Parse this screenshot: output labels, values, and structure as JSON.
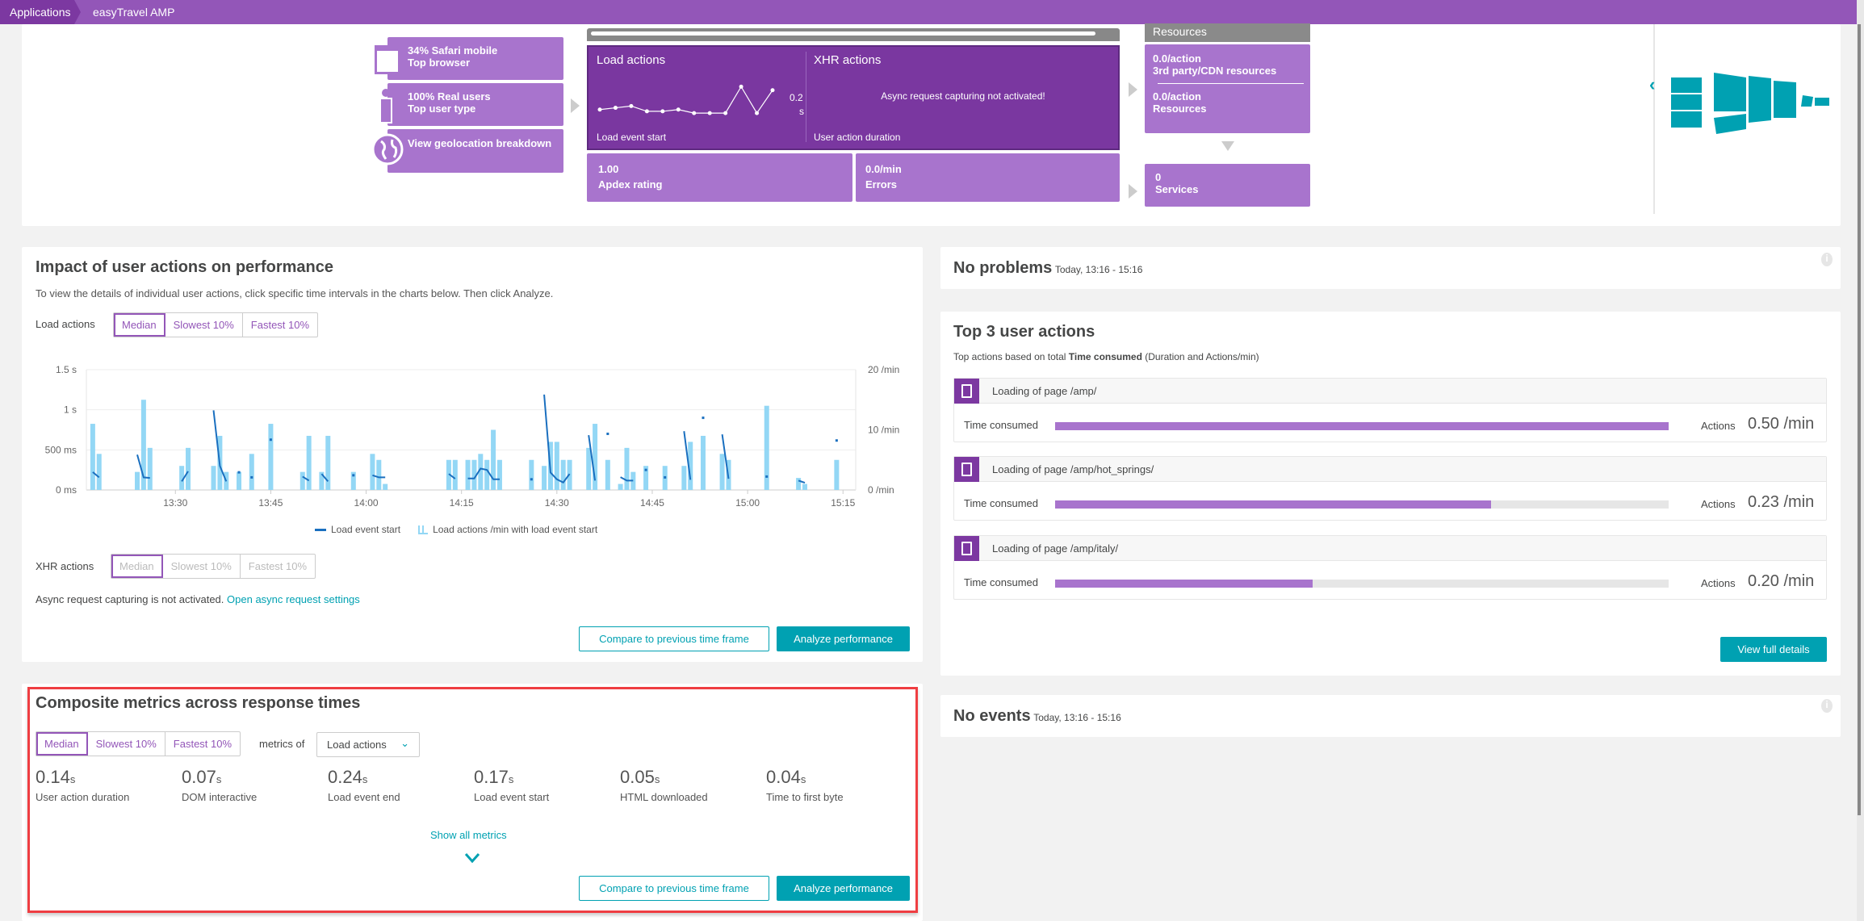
{
  "breadcrumb": {
    "items": [
      "Applications",
      "easyTravel AMP"
    ]
  },
  "flow": {
    "browser": {
      "value": "34% Safari mobile",
      "label": "Top browser",
      "icon": "browser-icon"
    },
    "user_type": {
      "value": "100% Real users",
      "label": "Top user type",
      "icon": "person-icon"
    },
    "geo": {
      "label": "View geolocation breakdown",
      "icon": "globe-icon"
    },
    "load_actions": {
      "title": "Load actions",
      "value": "0.2",
      "unit": "s",
      "footer": "Load event start",
      "sparkline": [
        0.17,
        0.18,
        0.19,
        0.16,
        0.16,
        0.17,
        0.15,
        0.15,
        0.15,
        0.3,
        0.15,
        0.28
      ]
    },
    "xhr_actions": {
      "title": "XHR actions",
      "message": "Async request capturing not activated!",
      "footer": "User action duration"
    },
    "apdex": {
      "value": "1.00",
      "label": "Apdex rating"
    },
    "errors": {
      "value": "0.0/min",
      "label": "Errors"
    },
    "resources": {
      "header": "Resources",
      "third_party_value": "0.0/action",
      "third_party_label": "3rd party/CDN resources",
      "resources_value": "0.0/action",
      "resources_label": "Resources"
    },
    "services": {
      "value": "0",
      "label": "Services"
    }
  },
  "impact": {
    "title": "Impact of user actions on performance",
    "description": "To view the details of individual user actions, click specific time intervals in the charts below. Then click Analyze.",
    "load_label": "Load actions",
    "tabs": [
      "Median",
      "Slowest 10%",
      "Fastest 10%"
    ],
    "xhr_label": "XHR actions",
    "async_text": "Async request capturing is not activated.",
    "async_link": "Open async request settings",
    "compare_button": "Compare to previous time frame",
    "analyze_button": "Analyze performance"
  },
  "chart_data": {
    "type": "bar+line",
    "x_ticks": [
      "13:30",
      "13:45",
      "14:00",
      "14:15",
      "14:30",
      "14:45",
      "15:00",
      "15:15"
    ],
    "xlim": [
      "13:16",
      "15:17"
    ],
    "y_left": {
      "ticks": [
        "0 ms",
        "500 ms",
        "1 s",
        "1.5 s"
      ],
      "ylim": [
        0,
        1500
      ],
      "unit": "ms"
    },
    "y_right": {
      "ticks": [
        "0 /min",
        "10 /min",
        "20 /min"
      ],
      "ylim": [
        0,
        20
      ],
      "unit": "/min"
    },
    "grid": true,
    "legend_position": "bottom",
    "colors": {
      "line": "#1a6fbf",
      "bar": "#93d7f5"
    },
    "legend": [
      "Load event start",
      "Load actions /min with load event start"
    ],
    "bars": [
      [
        "13:17",
        11
      ],
      [
        "13:18",
        6
      ],
      [
        "13:24",
        3
      ],
      [
        "13:25",
        15
      ],
      [
        "13:26",
        7
      ],
      [
        "13:31",
        4
      ],
      [
        "13:32",
        7
      ],
      [
        "13:36",
        4
      ],
      [
        "13:37",
        9
      ],
      [
        "13:38",
        3
      ],
      [
        "13:40",
        3
      ],
      [
        "13:42",
        6
      ],
      [
        "13:45",
        11
      ],
      [
        "13:50",
        3
      ],
      [
        "13:51",
        9
      ],
      [
        "13:53",
        3
      ],
      [
        "13:54",
        9
      ],
      [
        "13:58",
        3
      ],
      [
        "14:01",
        6
      ],
      [
        "14:02",
        5
      ],
      [
        "14:03",
        1
      ],
      [
        "14:13",
        5
      ],
      [
        "14:14",
        5
      ],
      [
        "14:16",
        5
      ],
      [
        "14:17",
        5
      ],
      [
        "14:18",
        6
      ],
      [
        "14:19",
        5
      ],
      [
        "14:20",
        10
      ],
      [
        "14:21",
        5
      ],
      [
        "14:26",
        5
      ],
      [
        "14:28",
        4
      ],
      [
        "14:29",
        8
      ],
      [
        "14:30",
        8
      ],
      [
        "14:31",
        5
      ],
      [
        "14:32",
        5
      ],
      [
        "14:35",
        7
      ],
      [
        "14:36",
        11
      ],
      [
        "14:38",
        5
      ],
      [
        "14:40",
        1
      ],
      [
        "14:41",
        7
      ],
      [
        "14:42",
        3
      ],
      [
        "14:44",
        4
      ],
      [
        "14:47",
        4
      ],
      [
        "14:50",
        4
      ],
      [
        "14:51",
        8
      ],
      [
        "14:53",
        9
      ],
      [
        "14:56",
        6
      ],
      [
        "14:57",
        5
      ],
      [
        "15:03",
        14
      ],
      [
        "15:08",
        2
      ],
      [
        "15:09",
        1
      ],
      [
        "15:14",
        5
      ]
    ],
    "line_segments": [
      [
        [
          "13:17",
          223
        ],
        [
          "13:18",
          157
        ]
      ],
      [
        [
          "13:24",
          440
        ],
        [
          "13:25",
          157
        ],
        [
          "13:26",
          150
        ]
      ],
      [
        [
          "13:31",
          107
        ],
        [
          "13:32",
          233
        ]
      ],
      [
        [
          "13:36",
          993
        ],
        [
          "13:37",
          300
        ],
        [
          "13:38",
          107
        ]
      ],
      [
        [
          "13:40",
          220
        ]
      ],
      [
        [
          "13:42",
          157
        ]
      ],
      [
        [
          "13:45",
          627
        ]
      ],
      [
        [
          "13:50",
          167
        ],
        [
          "13:51",
          117
        ]
      ],
      [
        [
          "13:53",
          200
        ],
        [
          "13:54",
          107
        ]
      ],
      [
        [
          "13:58",
          183
        ]
      ],
      [
        [
          "14:01",
          183
        ],
        [
          "14:02",
          157
        ],
        [
          "14:03",
          157
        ]
      ],
      [
        [
          "14:13",
          200
        ],
        [
          "14:14",
          140
        ]
      ],
      [
        [
          "14:16",
          143
        ],
        [
          "14:17",
          143
        ],
        [
          "14:18",
          267
        ],
        [
          "14:19",
          250
        ],
        [
          "14:20",
          133
        ],
        [
          "14:21",
          133
        ]
      ],
      [
        [
          "14:26",
          133
        ]
      ],
      [
        [
          "14:28",
          1190
        ],
        [
          "14:29",
          217
        ],
        [
          "14:30",
          133
        ],
        [
          "14:31",
          93
        ],
        [
          "14:32",
          200
        ]
      ],
      [
        [
          "14:35",
          683
        ],
        [
          "14:36",
          117
        ]
      ],
      [
        [
          "14:38",
          700
        ]
      ],
      [
        [
          "14:40",
          160
        ],
        [
          "14:41",
          117
        ],
        [
          "14:42",
          117
        ]
      ],
      [
        [
          "14:44",
          250
        ]
      ],
      [
        [
          "14:47",
          157
        ]
      ],
      [
        [
          "14:50",
          733
        ],
        [
          "14:51",
          127
        ]
      ],
      [
        [
          "14:53",
          900
        ]
      ],
      [
        [
          "14:56",
          693
        ],
        [
          "14:57",
          140
        ]
      ],
      [
        [
          "15:03",
          167
        ]
      ],
      [
        [
          "15:08",
          117
        ],
        [
          "15:09",
          90
        ]
      ],
      [
        [
          "15:14",
          617
        ]
      ]
    ]
  },
  "composite": {
    "title": "Composite metrics across response times",
    "tabs": [
      "Median",
      "Slowest 10%",
      "Fastest 10%"
    ],
    "metrics_of": "metrics of",
    "dropdown": "Load actions",
    "metrics": [
      {
        "value": "0.14",
        "unit": "s",
        "label": "User action duration"
      },
      {
        "value": "0.07",
        "unit": "s",
        "label": "DOM interactive"
      },
      {
        "value": "0.24",
        "unit": "s",
        "label": "Load event end"
      },
      {
        "value": "0.17",
        "unit": "s",
        "label": "Load event start"
      },
      {
        "value": "0.05",
        "unit": "s",
        "label": "HTML downloaded"
      },
      {
        "value": "0.04",
        "unit": "s",
        "label": "Time to first byte"
      }
    ],
    "show_all": "Show all metrics",
    "compare_button": "Compare to previous time frame",
    "analyze_button": "Analyze performance"
  },
  "problems": {
    "title": "No problems",
    "time": "Today, 13:16 - 15:16"
  },
  "top3": {
    "title": "Top 3 user actions",
    "desc_pre": "Top actions based on total ",
    "desc_bold": "Time consumed",
    "desc_post": " (Duration and Actions/min)",
    "time_label": "Time consumed",
    "actions_label": "Actions",
    "items": [
      {
        "name": "Loading of page /amp/",
        "rate": "0.50 /min",
        "fraction": 1.0
      },
      {
        "name": "Loading of page /amp/hot_springs/",
        "rate": "0.23 /min",
        "fraction": 0.71
      },
      {
        "name": "Loading of page /amp/italy/",
        "rate": "0.20 /min",
        "fraction": 0.42
      }
    ],
    "view_button": "View full details"
  },
  "events": {
    "title": "No events",
    "time": "Today, 13:16 - 15:16"
  }
}
